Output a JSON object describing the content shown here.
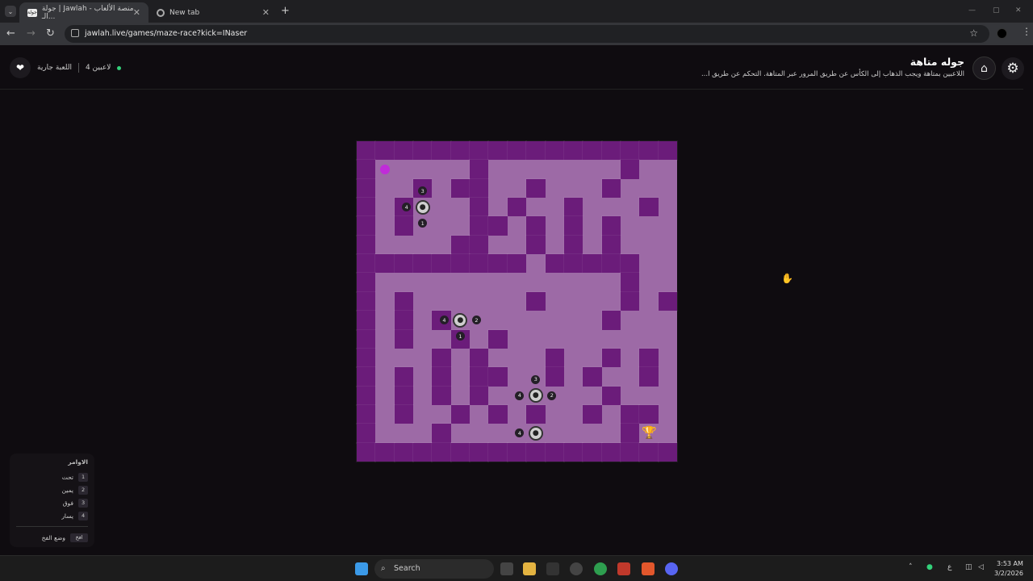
{
  "browser": {
    "tabs": [
      {
        "title": "جولة | Jawlah - منصة الألعاب الـ...",
        "favicon": "جولة",
        "active": true
      },
      {
        "title": "New tab",
        "active": false
      }
    ],
    "url": "jawlah.live/games/maze-race?kick=INaser"
  },
  "header": {
    "title": "جوله متاهة",
    "description": "اللاعبين بمتاهة ويجب الذهاب إلى الكأس عن طريق المرور عبر المتاهة. التحكم عن طريق ا...",
    "players_label": "4 لاعبين",
    "game_status": "اللعبة جارية"
  },
  "maze": {
    "grid": [
      "#################",
      "#S....#.......#..#",
      "#..#.##..#...#...#",
      "#.#...#.#..#...#.#",
      "#.#...##.#.#.#...#",
      "#....##..#.#.#...#",
      "#########.#####..#",
      "#.............#..#",
      "#.#......#....#.##",
      "#.#.#........#...#",
      "#.#..#.#.........#",
      "#...#.#...#..#.#.#",
      "#.#.#.##..#.#..#.#",
      "#.#.#.#......#...#",
      "#.#..#.#.#..#.##.#",
      "#...#.........#..#",
      "#################"
    ],
    "players": [
      {
        "label": "jawlah player 1",
        "badges": [
          "3",
          "4",
          "1"
        ]
      },
      {
        "label": "jawlah player 2",
        "badges": [
          "4",
          "2",
          "1"
        ]
      },
      {
        "label": "jawlah player 3",
        "badges": [
          "3",
          "4",
          "2"
        ]
      },
      {
        "label": "jawlah player 4",
        "badges": [
          "4"
        ]
      }
    ],
    "goal_icon": "trophy-icon",
    "colors": {
      "wall": "#6b1c7a",
      "path": "#9d6aa6",
      "start": "#c02cd8"
    }
  },
  "commands": {
    "title": "الاوامر",
    "items": [
      {
        "key": "1",
        "label": "تحت"
      },
      {
        "key": "2",
        "label": "يمين"
      },
      {
        "key": "3",
        "label": "فوق"
      },
      {
        "key": "4",
        "label": "يسار"
      }
    ],
    "trap_key": "افخ",
    "trap_label": "وضع الفخ"
  },
  "taskbar": {
    "search_placeholder": "Search",
    "lang": "ع",
    "time": "3:53 AM",
    "date": "3/2/2026"
  }
}
